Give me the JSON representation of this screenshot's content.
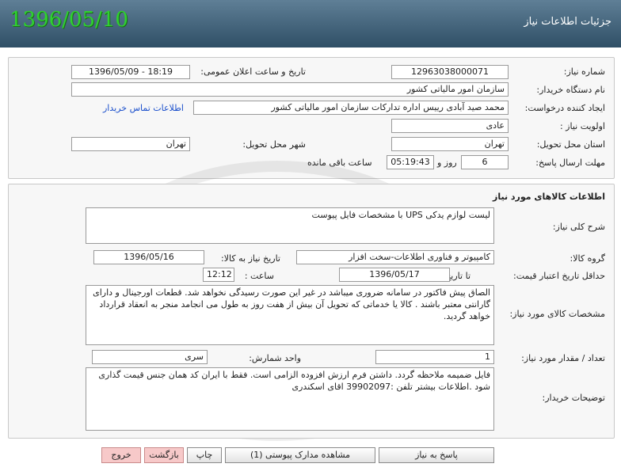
{
  "header": {
    "title": "جزئیات اطلاعات نیاز",
    "date": "1396/05/10"
  },
  "info": {
    "need_number_label": "شماره نیاز:",
    "need_number": "12963038000071",
    "announce_label": "تاریخ و ساعت اعلان عمومی:",
    "announce_value": "1396/05/09 - 18:19",
    "buyer_label": "نام دستگاه خریدار:",
    "buyer_value": "سازمان امور مالیاتی کشور",
    "creator_label": "ایجاد کننده درخواست:",
    "creator_value": "محمد صید آبادی  رییس اداره تدارکات سازمان امور مالیاتی کشور",
    "contact_link": "اطلاعات تماس خریدار",
    "priority_label": "اولویت نیاز :",
    "priority_value": "عادی",
    "province_label": "استان محل تحویل:",
    "province_value": "تهران",
    "city_label": "شهر محل تحویل:",
    "city_value": "تهران",
    "deadline_label": "مهلت ارسال پاسخ:",
    "deadline_days": "6",
    "deadline_days_suffix": "روز و",
    "deadline_time": "05:19:43",
    "deadline_remaining": "ساعت باقی مانده"
  },
  "goods": {
    "section_title": "اطلاعات کالاهای مورد نیاز",
    "summary_label": "شرح کلی نیاز:",
    "summary_value": "لیست لوازم یدکی UPS با مشخصات فایل پیوست",
    "group_label": "گروه کالا:",
    "group_value": "کامپیوتر و فناوری اطلاعات-سخت افزار",
    "need_date_label": "تاریخ نیاز به کالا:",
    "need_date_value": "1396/05/16",
    "validity_label": "حداقل تاریخ اعتبار قیمت:",
    "validity_to_label": "تا تاریخ :",
    "validity_date": "1396/05/17",
    "validity_time_label": "ساعت :",
    "validity_time": "12:12",
    "specs_label": "مشخصات کالای مورد نیاز:",
    "specs_value": "الصاق پیش فاکتور در سامانه ضروری میباشد در غیر این صورت رسیدگی نخواهد شد.  قطعات اورجینال و دارای گارانتی معتبر باشند . کالا یا خدماتی  که تحویل آن  بیش از هفت روز به طول می انجامد منجر به انعقاد قرارداد خواهد گردید.",
    "qty_label": "تعداد / مقدار مورد نیاز:",
    "qty_value": "1",
    "unit_label": "واحد شمارش:",
    "unit_value": "سری",
    "notes_label": "توضیحات خریدار:",
    "notes_value": "فایل ضمیمه ملاحظه گردد. داشتن فرم ارزش افزوده الزامی است. فقط با ایران کد همان جنس قیمت گذاری شود .اطلاعات بیشتر تلفن :39902097  اقای اسکندری"
  },
  "buttons": {
    "respond": "پاسخ به نیاز",
    "attachments": "مشاهده مدارک پیوستی (1)",
    "print": "چاپ",
    "back": "بازگشت",
    "exit": "خروج"
  },
  "colors": {
    "titlebar": "#2f4f66",
    "date_green": "#2fd12f",
    "link": "#1a4fcc",
    "exit_button": "#f7c9c9"
  }
}
